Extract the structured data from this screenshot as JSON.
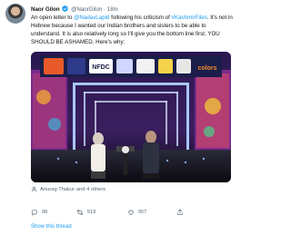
{
  "tweet": {
    "author_name": "Naor Gilon",
    "handle": "@NaorGilon",
    "separator": "·",
    "time": "18m",
    "text_intro": "An open letter to ",
    "mention": "@NadavLapid",
    "text_middle": " following his criticism of ",
    "hashtag": "#KashmirFiles",
    "text_rest": ". It's not in Hebrew because I wanted our Indian brothers and sisters to be able to understand. It is also relatively long so I'll give you the bottom line first. YOU SHOULD BE ASHAMED. Here's why:",
    "stage_logo": "NFDC",
    "stage_brand": "colors",
    "tagged": "Anurag Thakur and 4 others",
    "replies": "98",
    "retweets": "519",
    "likes": "957",
    "show_thread": "Show this thread"
  },
  "colors": {
    "accent": "#1d9bf0",
    "muted": "#536471",
    "text": "#0f1419"
  }
}
